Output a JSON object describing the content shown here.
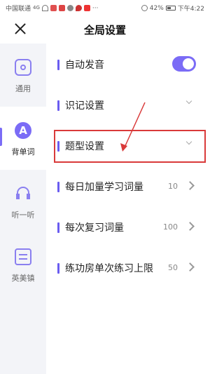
{
  "status_bar": {
    "carrier": "中国联通",
    "network": "4G",
    "battery": "42%",
    "time": "下午4:22"
  },
  "header": {
    "title": "全局设置",
    "close_icon": "close-icon"
  },
  "sidebar": {
    "items": [
      {
        "label": "通用",
        "icon": "settings-icon",
        "active": false
      },
      {
        "label": "背单词",
        "icon": "letter-a-icon",
        "active": true
      },
      {
        "label": "听一听",
        "icon": "headphones-icon",
        "active": false
      },
      {
        "label": "英美镇",
        "icon": "screen-icon",
        "active": false
      }
    ]
  },
  "settings": [
    {
      "label": "自动发音",
      "type": "toggle",
      "on": true
    },
    {
      "label": "识记设置",
      "type": "expand"
    },
    {
      "label": "题型设置",
      "type": "expand",
      "highlighted": true
    },
    {
      "label": "每日加量学习词量",
      "type": "value",
      "value": "10"
    },
    {
      "label": "每次复习词量",
      "type": "value",
      "value": "100"
    },
    {
      "label": "练功房单次练习上限",
      "type": "value",
      "value": "50"
    }
  ],
  "colors": {
    "accent": "#7b6cf6",
    "highlight_box": "#d93a3a",
    "sidebar_bg": "#f3f4f8"
  }
}
